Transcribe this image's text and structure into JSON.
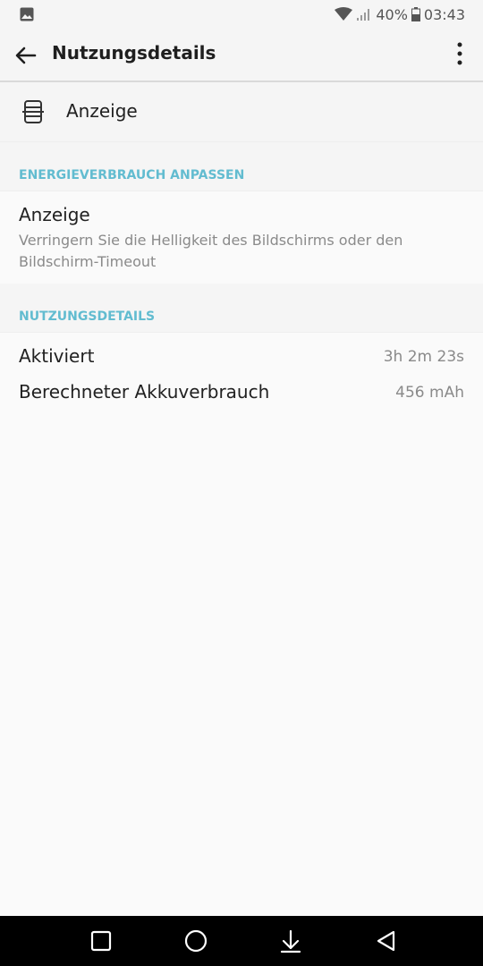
{
  "status_bar": {
    "battery_percent": "40%",
    "time": "03:43",
    "icons": [
      "image-notification-icon",
      "wifi-icon",
      "signal-icon",
      "battery-icon"
    ]
  },
  "app_bar": {
    "title": "Nutzungsdetails",
    "back_icon": "arrow-back-icon",
    "more_icon": "more-vert-icon"
  },
  "app_header": {
    "label": "Anzeige",
    "icon": "display-device-icon"
  },
  "sections": {
    "energy": {
      "header": "ENERGIEVERBRAUCH ANPASSEN",
      "item_title": "Anzeige",
      "item_summary": "Verringern Sie die Helligkeit des Bildschirms oder den Bildschirm-Timeout"
    },
    "usage": {
      "header": "NUTZUNGSDETAILS",
      "rows": [
        {
          "label": "Aktiviert",
          "value": "3h 2m 23s"
        },
        {
          "label": "Berechneter Akkuverbrauch",
          "value": "456 mAh"
        }
      ]
    }
  },
  "nav_bar": {
    "icons": [
      "recents-square-icon",
      "home-circle-icon",
      "notification-pulldown-icon",
      "back-triangle-icon"
    ]
  },
  "colors": {
    "accent": "#62bcd0",
    "background": "#fafafa",
    "header_background": "#f5f5f5",
    "nav_background": "#000000"
  }
}
